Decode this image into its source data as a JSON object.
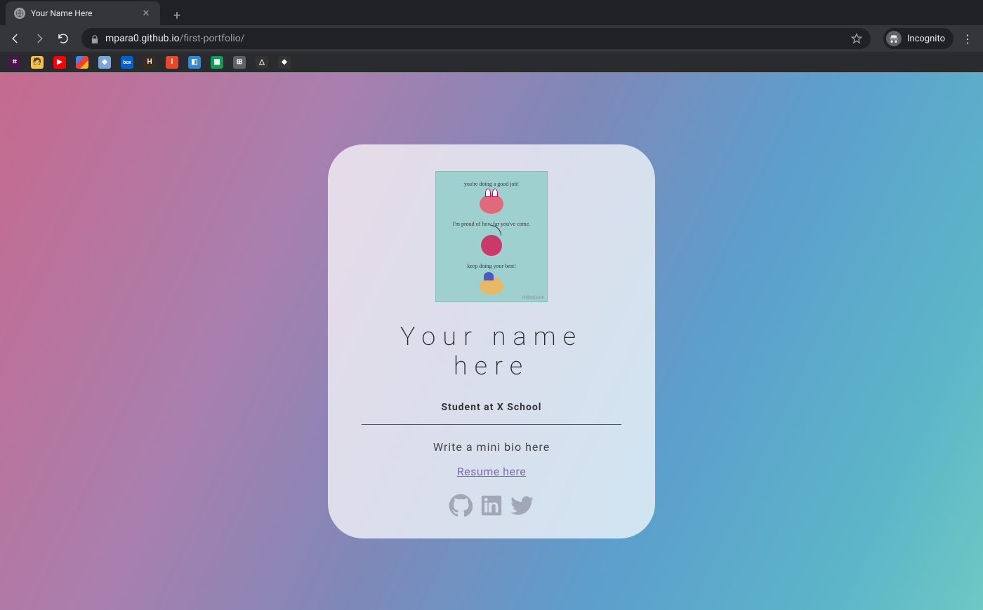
{
  "browser": {
    "tab_title": "Your Name Here",
    "url_host": "mpara0.github.io",
    "url_path": "/first-portfolio/",
    "incognito_label": "Incognito"
  },
  "bookmarks": [
    {
      "name": "slack",
      "bg": "#4a154b",
      "txt": "⌗"
    },
    {
      "name": "emoji",
      "bg": "#f2c14e",
      "txt": "🙂"
    },
    {
      "name": "youtube",
      "bg": "#ff0000",
      "txt": "▶"
    },
    {
      "name": "photos",
      "bg": "linear",
      "txt": ""
    },
    {
      "name": "cloud",
      "bg": "#7aa7d8",
      "txt": "◆"
    },
    {
      "name": "box",
      "bg": "#0061d5",
      "txt": "box"
    },
    {
      "name": "help",
      "bg": "#3a2b1a",
      "txt": "H"
    },
    {
      "name": "illinois",
      "bg": "#e84a27",
      "txt": "I"
    },
    {
      "name": "trello",
      "bg": "#2e8bd8",
      "txt": "◧"
    },
    {
      "name": "sheets",
      "bg": "#0f9d58",
      "txt": "▦"
    },
    {
      "name": "grid",
      "bg": "#5f6368",
      "txt": "⊞"
    },
    {
      "name": "drive",
      "bg": "#333",
      "txt": "△"
    },
    {
      "name": "other",
      "bg": "#333",
      "txt": "◆"
    }
  ],
  "card": {
    "hero": {
      "line1": "you're doing a good job!",
      "line2": "I'm proud of how far you've come.",
      "line3": "keep doing your best!",
      "credit": "chibird.com"
    },
    "name": "Your name here",
    "subtitle": "Student at X School",
    "bio": "Write a mini bio here",
    "resume_label": "Resume here"
  },
  "socials": {
    "github": "github-icon",
    "linkedin": "linkedin-icon",
    "twitter": "twitter-icon"
  }
}
